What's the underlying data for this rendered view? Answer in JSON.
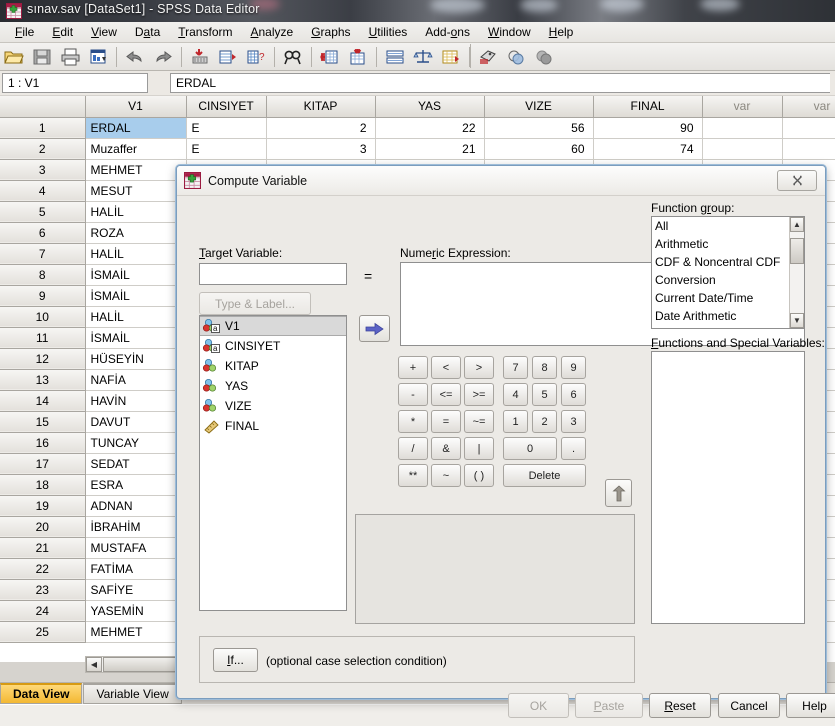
{
  "window": {
    "title": "sınav.sav [DataSet1] - SPSS Data Editor",
    "icon": "spss-data-editor-icon"
  },
  "menubar": {
    "items": [
      {
        "label": "File",
        "mnemonic": "F"
      },
      {
        "label": "Edit",
        "mnemonic": "E"
      },
      {
        "label": "View",
        "mnemonic": "V"
      },
      {
        "label": "Data",
        "mnemonic": "D"
      },
      {
        "label": "Transform",
        "mnemonic": "T"
      },
      {
        "label": "Analyze",
        "mnemonic": "A"
      },
      {
        "label": "Graphs",
        "mnemonic": "G"
      },
      {
        "label": "Utilities",
        "mnemonic": "U"
      },
      {
        "label": "Add-ons",
        "mnemonic": "o"
      },
      {
        "label": "Window",
        "mnemonic": "W"
      },
      {
        "label": "Help",
        "mnemonic": "H"
      }
    ]
  },
  "toolbar": {
    "buttons": [
      "open-file-icon",
      "save-file-icon",
      "print-icon",
      "recall-dialogs-icon",
      "undo-icon",
      "redo-icon",
      "goto-case-icon",
      "variables-icon",
      "find-icon",
      "insert-case-icon",
      "insert-variable-icon",
      "split-file-icon",
      "weight-cases-icon",
      "select-cases-icon",
      "value-labels-icon",
      "use-variable-sets-icon",
      "show-all-variables-icon"
    ]
  },
  "cellbar": {
    "cell_reference": "1 : V1",
    "cell_value": "ERDAL"
  },
  "grid": {
    "columns": [
      "V1",
      "CINSIYET",
      "KITAP",
      "YAS",
      "VIZE",
      "FINAL",
      "var",
      "var"
    ],
    "rows": [
      {
        "n": "1",
        "V1": "ERDAL",
        "CINSIYET": "E",
        "KITAP": "2",
        "YAS": "22",
        "VIZE": "56",
        "FINAL": "90"
      },
      {
        "n": "2",
        "V1": "Muzaffer",
        "CINSIYET": "E",
        "KITAP": "3",
        "YAS": "21",
        "VIZE": "60",
        "FINAL": "74"
      },
      {
        "n": "3",
        "V1": "MEHMET",
        "CINSIYET": "",
        "KITAP": "",
        "YAS": "",
        "VIZE": "",
        "FINAL": ""
      },
      {
        "n": "4",
        "V1": "MESUT",
        "CINSIYET": "",
        "KITAP": "",
        "YAS": "",
        "VIZE": "",
        "FINAL": ""
      },
      {
        "n": "5",
        "V1": "HALİL",
        "CINSIYET": "",
        "KITAP": "",
        "YAS": "",
        "VIZE": "",
        "FINAL": ""
      },
      {
        "n": "6",
        "V1": "ROZA",
        "CINSIYET": "",
        "KITAP": "",
        "YAS": "",
        "VIZE": "",
        "FINAL": ""
      },
      {
        "n": "7",
        "V1": "HALİL",
        "CINSIYET": "",
        "KITAP": "",
        "YAS": "",
        "VIZE": "",
        "FINAL": ""
      },
      {
        "n": "8",
        "V1": "İSMAİL",
        "CINSIYET": "",
        "KITAP": "",
        "YAS": "",
        "VIZE": "",
        "FINAL": ""
      },
      {
        "n": "9",
        "V1": "İSMAİL",
        "CINSIYET": "",
        "KITAP": "",
        "YAS": "",
        "VIZE": "",
        "FINAL": ""
      },
      {
        "n": "10",
        "V1": "HALİL",
        "CINSIYET": "",
        "KITAP": "",
        "YAS": "",
        "VIZE": "",
        "FINAL": ""
      },
      {
        "n": "11",
        "V1": "İSMAİL",
        "CINSIYET": "",
        "KITAP": "",
        "YAS": "",
        "VIZE": "",
        "FINAL": ""
      },
      {
        "n": "12",
        "V1": "HÜSEYİN",
        "CINSIYET": "",
        "KITAP": "",
        "YAS": "",
        "VIZE": "",
        "FINAL": ""
      },
      {
        "n": "13",
        "V1": "NAFİA",
        "CINSIYET": "",
        "KITAP": "",
        "YAS": "",
        "VIZE": "",
        "FINAL": ""
      },
      {
        "n": "14",
        "V1": "HAVİN",
        "CINSIYET": "",
        "KITAP": "",
        "YAS": "",
        "VIZE": "",
        "FINAL": ""
      },
      {
        "n": "15",
        "V1": "DAVUT",
        "CINSIYET": "",
        "KITAP": "",
        "YAS": "",
        "VIZE": "",
        "FINAL": ""
      },
      {
        "n": "16",
        "V1": "TUNCAY",
        "CINSIYET": "",
        "KITAP": "",
        "YAS": "",
        "VIZE": "",
        "FINAL": ""
      },
      {
        "n": "17",
        "V1": "SEDAT",
        "CINSIYET": "",
        "KITAP": "",
        "YAS": "",
        "VIZE": "",
        "FINAL": ""
      },
      {
        "n": "18",
        "V1": "ESRA",
        "CINSIYET": "",
        "KITAP": "",
        "YAS": "",
        "VIZE": "",
        "FINAL": ""
      },
      {
        "n": "19",
        "V1": "ADNAN",
        "CINSIYET": "",
        "KITAP": "",
        "YAS": "",
        "VIZE": "",
        "FINAL": ""
      },
      {
        "n": "20",
        "V1": "İBRAHİM",
        "CINSIYET": "",
        "KITAP": "",
        "YAS": "",
        "VIZE": "",
        "FINAL": ""
      },
      {
        "n": "21",
        "V1": "MUSTAFA",
        "CINSIYET": "",
        "KITAP": "",
        "YAS": "",
        "VIZE": "",
        "FINAL": ""
      },
      {
        "n": "22",
        "V1": "FATİMA",
        "CINSIYET": "",
        "KITAP": "",
        "YAS": "",
        "VIZE": "",
        "FINAL": ""
      },
      {
        "n": "23",
        "V1": "SAFİYE",
        "CINSIYET": "",
        "KITAP": "",
        "YAS": "",
        "VIZE": "",
        "FINAL": ""
      },
      {
        "n": "24",
        "V1": "YASEMİN",
        "CINSIYET": "",
        "KITAP": "",
        "YAS": "",
        "VIZE": "",
        "FINAL": ""
      },
      {
        "n": "25",
        "V1": "MEHMET",
        "CINSIYET": "",
        "KITAP": "",
        "YAS": "",
        "VIZE": "",
        "FINAL": ""
      }
    ],
    "selected_cell": {
      "row": "1",
      "column": "V1"
    }
  },
  "view_tabs": [
    {
      "label": "Data View",
      "active": true
    },
    {
      "label": "Variable View",
      "active": false
    }
  ],
  "dialog": {
    "title": "Compute Variable",
    "icon": "spss-dialog-icon",
    "close_label": "✕",
    "target_variable_label": "Target Variable:",
    "target_variable_value": "",
    "equals_sign": "=",
    "type_label_button": "Type & Label...",
    "numeric_expression_label": "Numeric Expression:",
    "numeric_expression_value": "",
    "variables": [
      {
        "name": "V1",
        "type": "string",
        "icon": "string-variable-icon",
        "selected": true
      },
      {
        "name": "CINSIYET",
        "type": "string",
        "icon": "string-variable-icon",
        "selected": false
      },
      {
        "name": "KITAP",
        "type": "nominal",
        "icon": "nominal-variable-icon",
        "selected": false
      },
      {
        "name": "YAS",
        "type": "nominal",
        "icon": "nominal-variable-icon",
        "selected": false
      },
      {
        "name": "VIZE",
        "type": "nominal",
        "icon": "nominal-variable-icon",
        "selected": false
      },
      {
        "name": "FINAL",
        "type": "scale",
        "icon": "scale-variable-icon",
        "selected": false
      }
    ],
    "transfer_button_icon": "right-arrow-icon",
    "up-arrow_icon": "up-arrow-icon",
    "keypad": [
      "+",
      "<",
      ">",
      "7",
      "8",
      "9",
      "-",
      "<=",
      ">=",
      "4",
      "5",
      "6",
      "*",
      "=",
      "~=",
      "1",
      "2",
      "3",
      "/",
      "&",
      "|",
      "0",
      ".",
      "**",
      "~",
      "( )",
      "Delete"
    ],
    "function_group_label": "Function group:",
    "function_groups": [
      "All",
      "Arithmetic",
      "CDF & Noncentral CDF",
      "Conversion",
      "Current Date/Time",
      "Date Arithmetic"
    ],
    "functions_label": "Functions and Special Variables:",
    "functions": [],
    "if_button": "If...",
    "if_hint": "(optional case selection condition)",
    "buttons": [
      {
        "label": "OK",
        "enabled": false
      },
      {
        "label": "Paste",
        "enabled": false
      },
      {
        "label": "Reset",
        "enabled": true
      },
      {
        "label": "Cancel",
        "enabled": true
      },
      {
        "label": "Help",
        "enabled": true
      }
    ]
  },
  "colors": {
    "selection_blue": "#a8cdec",
    "active_tab_gold": "#f3b832",
    "dialog_bg": "#eceae6"
  }
}
